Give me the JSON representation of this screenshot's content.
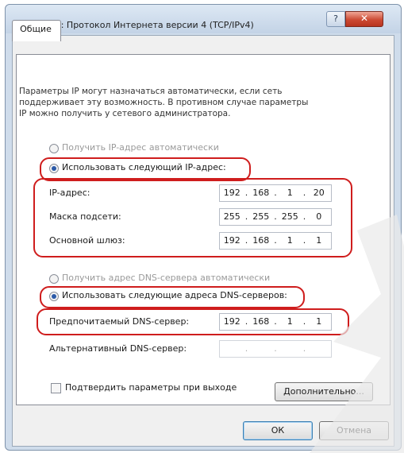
{
  "window": {
    "title": "Свойства: Протокол Интернета версии 4 (TCP/IPv4)",
    "help_glyph": "?",
    "close_glyph": "✕"
  },
  "tabs": [
    {
      "label": "Общие",
      "selected": true
    }
  ],
  "description": [
    "Параметры IP могут назначаться автоматически, если сеть",
    "поддерживает эту возможность. В противном случае параметры",
    "IP можно получить у сетевого администратора."
  ],
  "ip_mode": {
    "auto_label": "Получить IP-адрес автоматически",
    "manual_label": "Использовать следующий IP-адрес:",
    "selected": "manual"
  },
  "ip_fields": [
    {
      "label": "IP-адрес:",
      "octets": [
        "192",
        "168",
        "1",
        "20"
      ]
    },
    {
      "label": "Маска подсети:",
      "octets": [
        "255",
        "255",
        "255",
        "0"
      ]
    },
    {
      "label": "Основной шлюз:",
      "octets": [
        "192",
        "168",
        "1",
        "1"
      ]
    }
  ],
  "dns_mode": {
    "auto_label": "Получить адрес DNS-сервера автоматически",
    "manual_label": "Использовать следующие адреса DNS-серверов:",
    "selected": "manual"
  },
  "dns_fields": [
    {
      "label": "Предпочитаемый DNS-сервер:",
      "octets": [
        "192",
        "168",
        "1",
        "1"
      ]
    },
    {
      "label": "Альтернативный DNS-сервер:",
      "octets": [
        "",
        "",
        "",
        ""
      ]
    }
  ],
  "validate_checkbox": {
    "label": "Подтвердить параметры при выходе",
    "checked": false
  },
  "buttons": {
    "advanced": "Дополнительно...",
    "ok": "ОК",
    "cancel": "Отмена"
  },
  "colors": {
    "highlight": "#cf1d1d",
    "titlebar": "#c9d7e8",
    "close": "#c4402b",
    "radio_dot": "#2b5aa8"
  }
}
